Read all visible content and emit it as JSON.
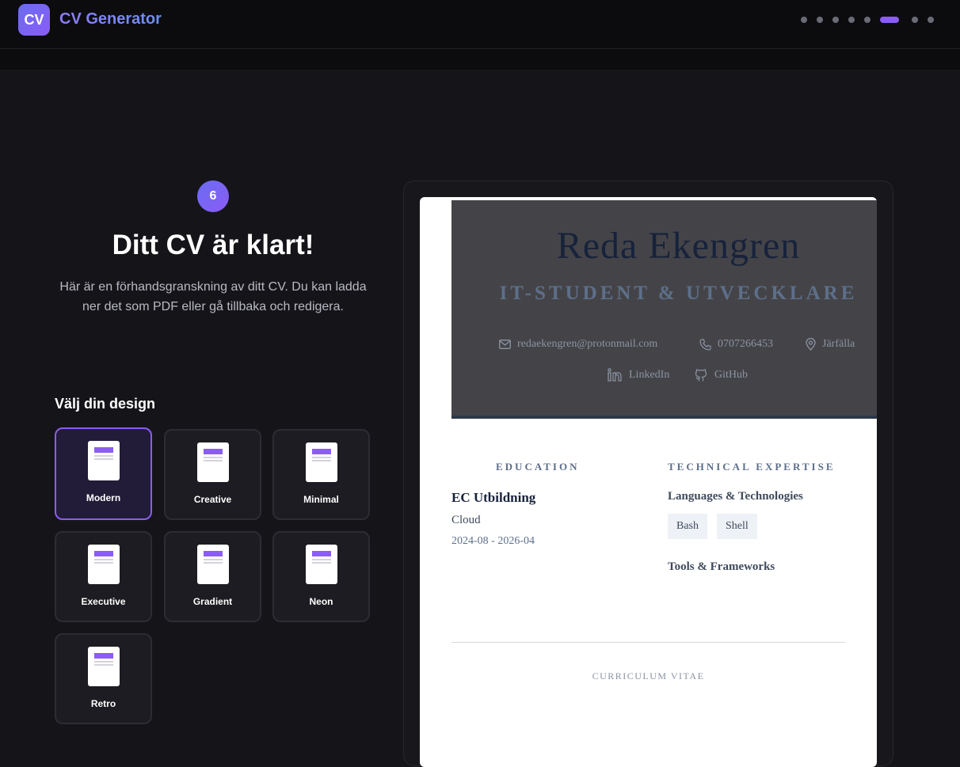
{
  "app": {
    "logo_text": "CV",
    "title": "CV Generator"
  },
  "progress": {
    "steps_total": 9,
    "current_step_index": 5
  },
  "step": {
    "number": "6",
    "heading": "Ditt CV är klart!",
    "subtitle": "Här är en förhandsgranskning av ditt CV. Du kan ladda ner det som PDF eller gå tillbaka och redigera."
  },
  "design": {
    "label": "Välj din design",
    "selected": "Modern",
    "templates": [
      "Modern",
      "Creative",
      "Minimal",
      "Executive",
      "Gradient",
      "Neon",
      "Retro"
    ]
  },
  "cv": {
    "name": "Reda Ekengren",
    "role": "IT-STUDENT & UTVECKLARE",
    "email": "redaekengren@protonmail.com",
    "phone": "0707266453",
    "location": "Järfälla",
    "linkedin": "LinkedIn",
    "github": "GitHub",
    "education_title": "EDUCATION",
    "education": {
      "school": "EC Utbildning",
      "program": "Cloud",
      "dates": "2024-08 - 2026-04"
    },
    "expertise_title": "TECHNICAL EXPERTISE",
    "languages_heading": "Languages & Technologies",
    "languages": [
      "Bash",
      "Shell"
    ],
    "tools_heading": "Tools & Frameworks",
    "footer": "CURRICULUM VITAE"
  },
  "colors": {
    "accent": "#8b5cf6",
    "accent_alt": "#6a6cf2",
    "background": "#151519"
  }
}
